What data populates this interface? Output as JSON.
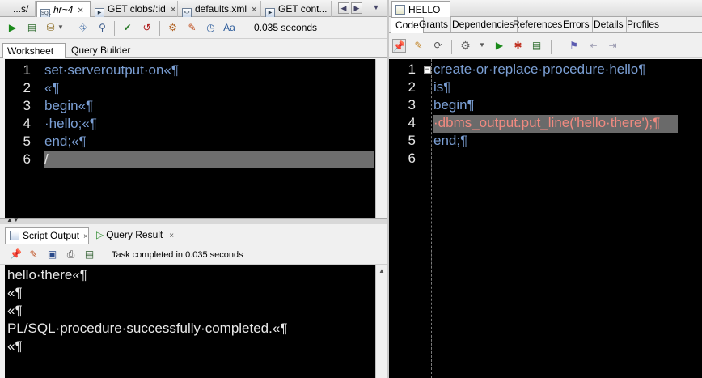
{
  "left_tabs": [
    {
      "label": "...s/",
      "icon": "sql-file-icon"
    },
    {
      "label": "hr~4",
      "icon": "sql-worksheet-icon",
      "active": true
    },
    {
      "label": "GET clobs/:id",
      "icon": "rest-handler-icon"
    },
    {
      "label": "defaults.xml",
      "icon": "xml-file-icon"
    },
    {
      "label": "GET cont...",
      "icon": "rest-handler-icon"
    }
  ],
  "worksheet_toolbar": {
    "timing": "0.035 seconds"
  },
  "worksheet_subtabs": [
    "Worksheet",
    "Query Builder"
  ],
  "worksheet_lines": [
    {
      "n": "1",
      "text": "set·serveroutput·on«¶"
    },
    {
      "n": "2",
      "text": "«¶"
    },
    {
      "n": "3",
      "text": "begin«¶"
    },
    {
      "n": "4",
      "text": "·hello;«¶"
    },
    {
      "n": "5",
      "text": "end;«¶"
    },
    {
      "n": "6",
      "text": "/"
    }
  ],
  "output_tabs": [
    {
      "label": "Script Output",
      "close": "×"
    },
    {
      "label": "Query Result",
      "close": "×"
    }
  ],
  "output_status": "Task completed in 0.035 seconds",
  "output_lines": [
    "hello·there«¶",
    "«¶",
    "«¶",
    "PL/SQL·procedure·successfully·completed.«¶",
    "«¶"
  ],
  "right_tab": {
    "label": "HELLO"
  },
  "right_subtabs": [
    "Code",
    "Grants",
    "Dependencies",
    "References",
    "Errors",
    "Details",
    "Profiles"
  ],
  "right_lines": [
    {
      "n": "1",
      "text": "create·or·replace·procedure·hello¶"
    },
    {
      "n": "2",
      "text": "is¶"
    },
    {
      "n": "3",
      "text": "begin¶"
    },
    {
      "n": "4",
      "text": "·dbms_output.put_line('hello·there');¶"
    },
    {
      "n": "5",
      "text": "end;¶"
    },
    {
      "n": "6",
      "text": ""
    }
  ],
  "colors": {
    "editor_bg": "#000000",
    "keyword": "#7b9fd4",
    "current_line": "#6e6e6e",
    "highlight_text": "#f08a80"
  }
}
